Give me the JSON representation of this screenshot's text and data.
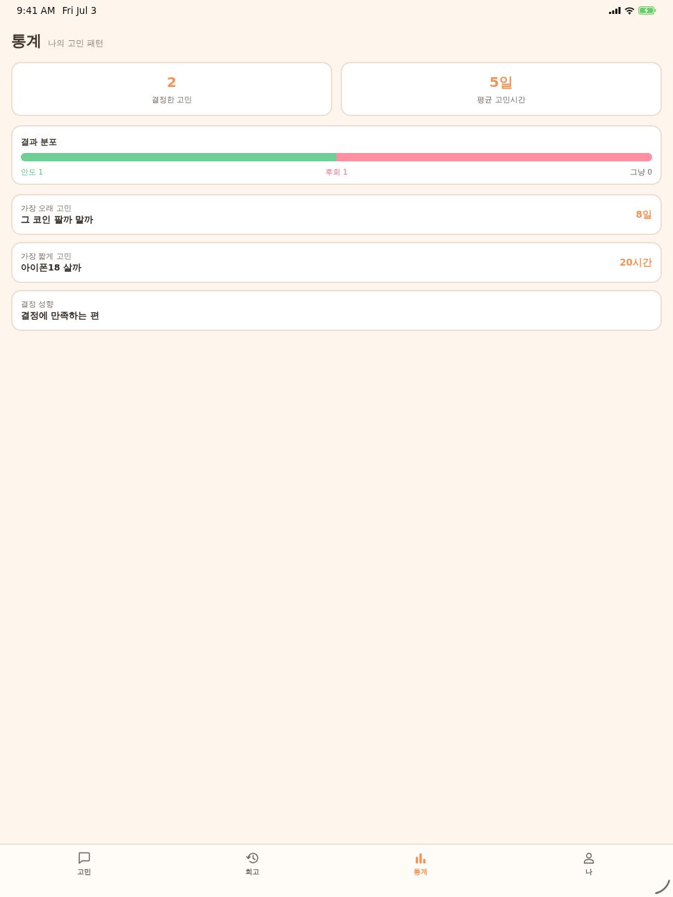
{
  "status_bar": {
    "time": "9:41 AM",
    "date": "Fri Jul 3"
  },
  "header": {
    "title": "통계",
    "subtitle": "나의 고민 패턴"
  },
  "summary_cards": [
    {
      "value": "2",
      "label": "결정한 고민"
    },
    {
      "value": "5일",
      "label": "평균 고민시간"
    }
  ],
  "distribution": {
    "title": "결과 분포",
    "bar": [
      {
        "level": 0.5,
        "color": "#6fcf97"
      },
      {
        "level": 0.5,
        "color": "#ff8fa1"
      }
    ],
    "legend": [
      {
        "label": "안도 1",
        "color": "#5cc38a"
      },
      {
        "label": "후회 1",
        "color": "#ea6f8a"
      },
      {
        "label": "그냥 0",
        "color": "#6e655d"
      }
    ]
  },
  "insights": [
    {
      "label": "가장 오래 고민",
      "value": "그 코인 팔까 말까",
      "badge": "8일"
    },
    {
      "label": "가장 짧게 고민",
      "value": "아이폰18 살까",
      "badge": "20시간"
    },
    {
      "label": "결정 성향",
      "value": "결정에 만족하는 편"
    }
  ],
  "tab_bar": [
    {
      "label": "고민",
      "kind": "chat",
      "selected": false
    },
    {
      "label": "회고",
      "kind": "history",
      "selected": false
    },
    {
      "label": "통계",
      "kind": "chart",
      "selected": true
    },
    {
      "label": "나",
      "kind": "person",
      "selected": false
    }
  ]
}
